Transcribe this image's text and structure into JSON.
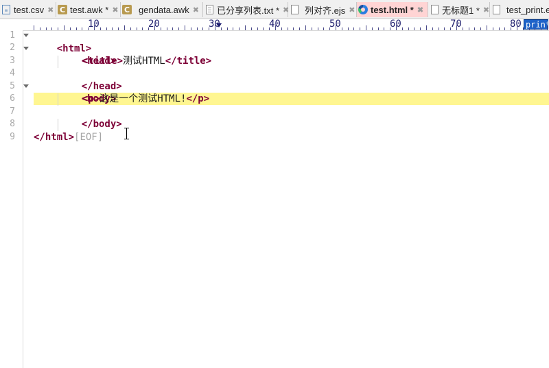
{
  "tabs": [
    {
      "label": "test.csv",
      "icon": "csv-file-icon",
      "active": false
    },
    {
      "label": "test.awk *",
      "icon": "c-file-icon",
      "active": false
    },
    {
      "label": "gendata.awk",
      "icon": "c-file-icon",
      "active": false
    },
    {
      "label": "已分享列表.txt *",
      "icon": "text-file-icon",
      "active": false
    },
    {
      "label": "列对齐.ejs",
      "icon": "blank-file-icon",
      "active": false
    },
    {
      "label": "test.html *",
      "icon": "edge-browser-icon",
      "active": true
    },
    {
      "label": "无标题1 *",
      "icon": "blank-file-icon",
      "active": false
    },
    {
      "label": "test_print.e",
      "icon": "blank-file-icon",
      "active": false
    }
  ],
  "close_glyph": "✖",
  "ruler": {
    "numbers": [
      "10",
      "20",
      "30",
      "40",
      "50",
      "60",
      "70",
      "80"
    ],
    "function_box": "printf"
  },
  "line_numbers": [
    "1",
    "2",
    "3",
    "4",
    "5",
    "6",
    "7",
    "8",
    "9"
  ],
  "code": {
    "l1": {
      "tag_open": "<html>"
    },
    "l2": {
      "tag_open": "<head>"
    },
    "l3": {
      "tag_open": "<title>",
      "text": "测试HTML",
      "tag_close": "</title>"
    },
    "l4": {
      "tag_close": "</head>"
    },
    "l5": {
      "tag_open": "<body>"
    },
    "l6": {
      "tag_open": "<p>",
      "text": "这是一个测试HTML!",
      "tag_close": "</p>"
    },
    "l7": {
      "tag_close": "</body>"
    },
    "l9": {
      "tag_close": "</html>",
      "eof": "[EOF]"
    }
  },
  "colors": {
    "active_tab_bg": "#ffd4d4",
    "current_line_highlight": "#fff691",
    "tag_color": "#7d0036",
    "line_number_color": "#a8a8a8"
  }
}
